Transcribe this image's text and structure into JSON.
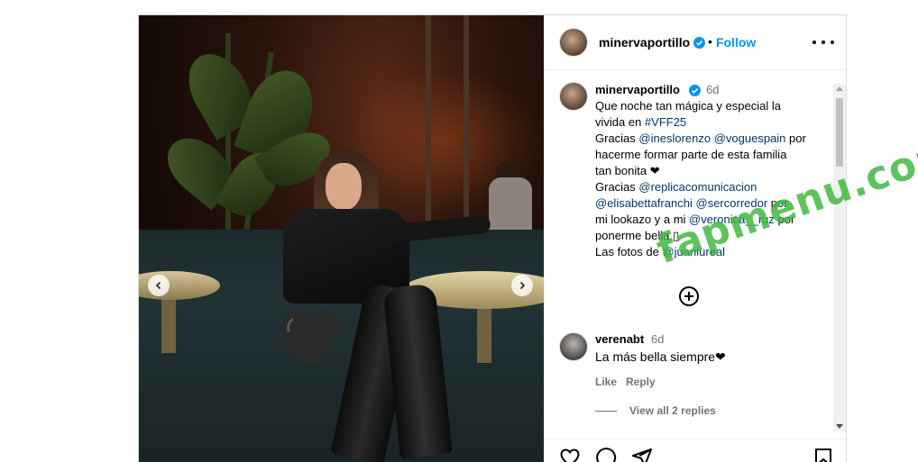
{
  "post": {
    "username": "minervaportillo",
    "follow_label": "Follow",
    "separator": "•",
    "caption": {
      "username": "minervaportillo",
      "time": "6d",
      "lines": [
        [
          {
            "t": "Que noche tan mágica y especial la"
          }
        ],
        [
          {
            "t": "vivida en "
          },
          {
            "t": "#VFF25",
            "link": true
          }
        ],
        [
          {
            "t": "Gracias "
          },
          {
            "t": "@ineslorenzo",
            "link": true
          },
          {
            "t": " "
          },
          {
            "t": "@voguespain",
            "link": true
          },
          {
            "t": " por"
          }
        ],
        [
          {
            "t": "hacerme formar parte de esta familia"
          }
        ],
        [
          {
            "t": "tan bonita ❤"
          }
        ],
        [
          {
            "t": "Gracias "
          },
          {
            "t": "@replicacomunicacion",
            "link": true
          }
        ],
        [
          {
            "t": "@elisabettafranchi",
            "link": true
          },
          {
            "t": " "
          },
          {
            "t": "@sercorredor",
            "link": true
          },
          {
            "t": " por"
          }
        ],
        [
          {
            "t": "mi lookazo y a mi "
          },
          {
            "t": "@veronica__ruz",
            "link": true
          },
          {
            "t": " por"
          }
        ],
        [
          {
            "t": "ponerme bella ▯"
          }
        ],
        [
          {
            "t": "Las fotos de "
          },
          {
            "t": "@juanlureal",
            "link": true
          }
        ]
      ]
    },
    "comment": {
      "username": "verenabt",
      "time": "6d",
      "text": "La más bella siempre❤",
      "like_label": "Like",
      "reply_label": "Reply",
      "view_replies_label": "View all 2 replies"
    }
  },
  "watermark": "fapmenu.com",
  "colors": {
    "link": "#00376b",
    "follow": "#0095f6",
    "muted": "#737373",
    "verified": "#0095f6",
    "watermark": "#3cb43c"
  },
  "icons": {
    "verified": "verified-badge-icon",
    "more": "more-options-icon",
    "add_comment": "plus-circle-icon",
    "like": "heart-icon",
    "comment": "comment-bubble-icon",
    "share": "paper-plane-icon",
    "save": "bookmark-icon",
    "prev": "chevron-left-icon",
    "next": "chevron-right-icon",
    "sticker": "heart-sticker-icon"
  }
}
